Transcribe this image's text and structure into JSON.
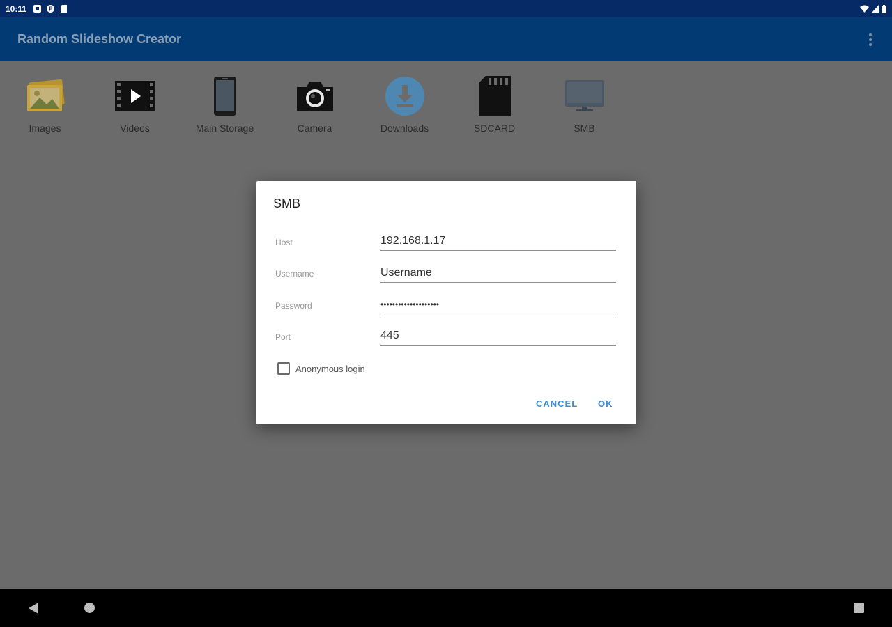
{
  "status_bar": {
    "time": "10:11",
    "icons": [
      "notification-square-icon",
      "p-app-icon",
      "sd-card-icon",
      "wifi-icon",
      "signal-icon",
      "battery-icon"
    ]
  },
  "app_bar": {
    "title": "Random Slideshow Creator",
    "menu_icon": "overflow-menu-icon"
  },
  "sources": [
    {
      "label": "Images",
      "icon": "images-icon"
    },
    {
      "label": "Videos",
      "icon": "videos-icon"
    },
    {
      "label": "Main Storage",
      "icon": "phone-icon"
    },
    {
      "label": "Camera",
      "icon": "camera-icon"
    },
    {
      "label": "Downloads",
      "icon": "download-icon"
    },
    {
      "label": "SDCARD",
      "icon": "sdcard-icon"
    },
    {
      "label": "SMB",
      "icon": "monitor-icon"
    }
  ],
  "dialog": {
    "title": "SMB",
    "host": {
      "label": "Host",
      "value": "192.168.1.17"
    },
    "username": {
      "label": "Username",
      "value": "Username"
    },
    "password": {
      "label": "Password",
      "value": "••••••••••••••••••••"
    },
    "port": {
      "label": "Port",
      "value": "445"
    },
    "anonymous": {
      "label": "Anonymous login",
      "checked": false
    },
    "cancel_label": "CANCEL",
    "ok_label": "OK"
  },
  "nav_bar": {
    "icons": [
      "back-icon",
      "home-icon",
      "recents-icon"
    ]
  },
  "colors": {
    "status_bar": "#062a66",
    "app_bar": "#023b73",
    "background": "#6b6b6b",
    "accent": "#3b8fd6"
  }
}
